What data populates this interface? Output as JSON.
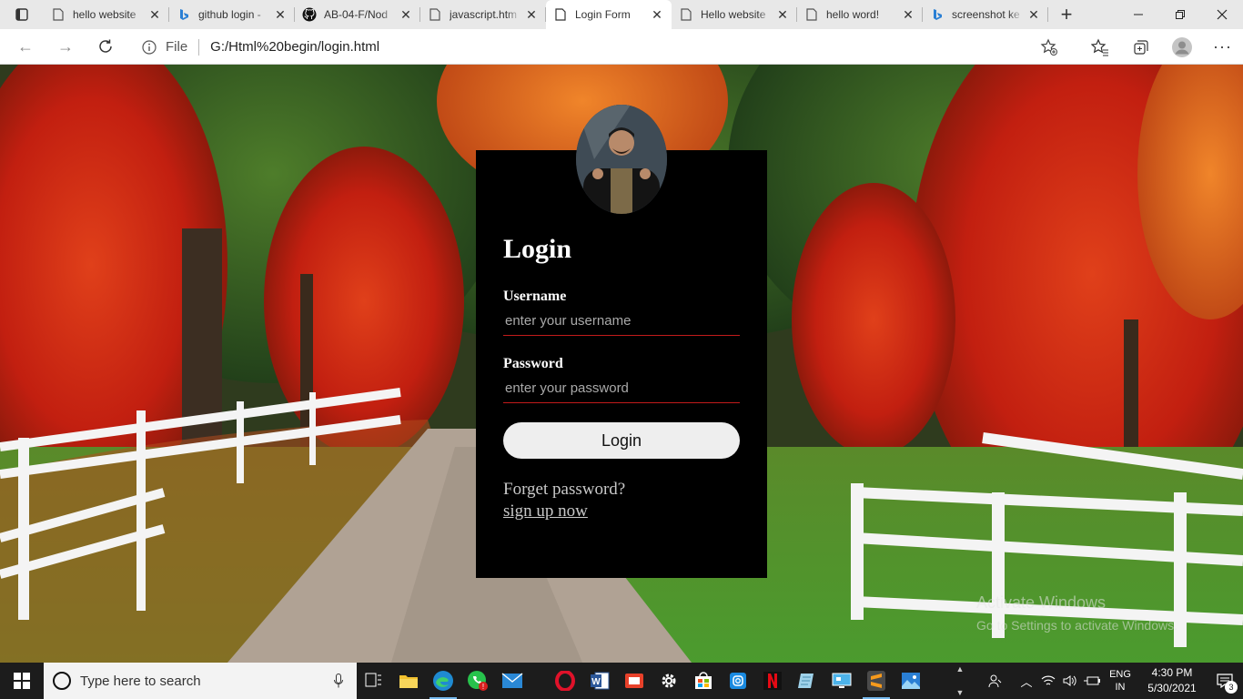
{
  "browser": {
    "tabs": [
      {
        "title": "hello website",
        "icon": "page-icon"
      },
      {
        "title": "github login -",
        "icon": "bing-icon"
      },
      {
        "title": "AB-04-F/Nod",
        "icon": "github-icon"
      },
      {
        "title": "javascript.htm",
        "icon": "page-icon"
      },
      {
        "title": "Login Form",
        "icon": "page-icon",
        "active": true
      },
      {
        "title": "Hello website",
        "icon": "page-icon"
      },
      {
        "title": "hello word!",
        "icon": "page-icon"
      },
      {
        "title": "screenshot ke",
        "icon": "bing-icon"
      }
    ],
    "address": {
      "scheme_label": "File",
      "url": "G:/Html%20begin/login.html"
    }
  },
  "login": {
    "title": "Login",
    "username_label": "Username",
    "username_placeholder": "enter your username",
    "password_label": "Password",
    "password_placeholder": "enter your password",
    "submit_label": "Login",
    "forgot_text": "Forget password?",
    "signup_text": "sign up now"
  },
  "watermark": {
    "line1": "Activate Windows",
    "line2": "Go to Settings to activate Windows."
  },
  "taskbar": {
    "search_placeholder": "Type here to search",
    "language": "ENG",
    "region": "IN",
    "time": "4:30 PM",
    "date": "5/30/2021",
    "notification_count": "3"
  },
  "colors": {
    "accent_underline": "#c21b1b",
    "login_panel": "#000000",
    "button_bg": "#eeeeee"
  }
}
